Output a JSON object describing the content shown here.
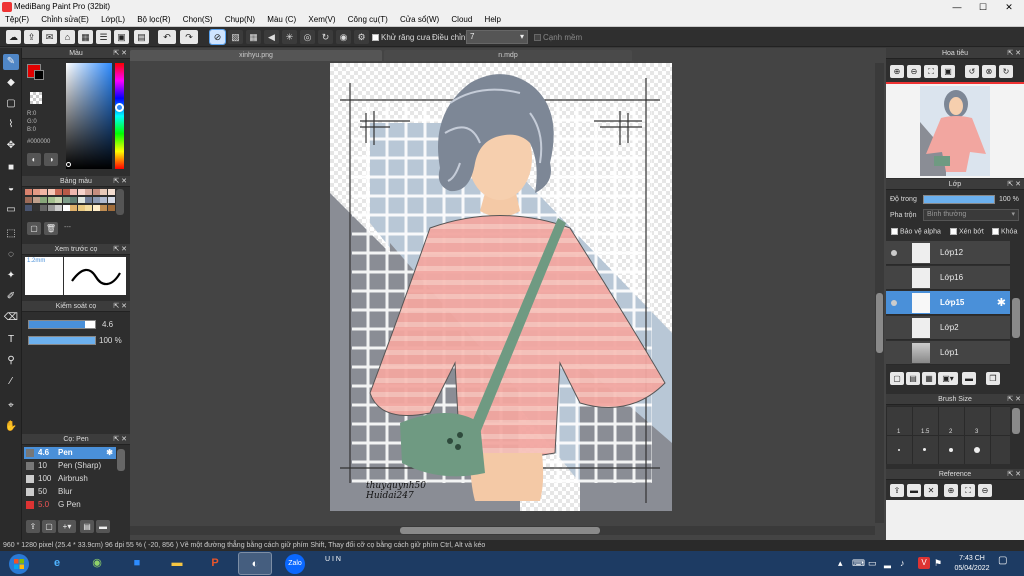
{
  "window": {
    "title": "MediBang Paint Pro (32bit)"
  },
  "menu": [
    "Tệp(F)",
    "Chỉnh sửa(E)",
    "Lớp(L)",
    "Bộ lọc(R)",
    "Chọn(S)",
    "Chụp(N)",
    "Màu (C)",
    "Xem(V)",
    "Công cụ(T)",
    "Cửa sổ(W)",
    "Cloud",
    "Help"
  ],
  "toolbar": {
    "antialias_label": "Khử răng cưa",
    "adjust_label": "Điều chỉnh",
    "adjust_value": "7",
    "snap_label": "Cạnh mềm"
  },
  "panels": {
    "color": {
      "title": "Màu",
      "r": "R:0",
      "g": "G:0",
      "b": "B:0",
      "hex": "#000000",
      "primary": "#000000",
      "secondary": "#e00000"
    },
    "palette": {
      "title": "Bảng màu",
      "more": "---"
    },
    "brush_preview": {
      "title": "Xem trước cọ",
      "size": "1.2mm"
    },
    "brush_control": {
      "title": "Kiểm soát cọ",
      "size_value": "4.6",
      "opacity_value": "100 %",
      "size_fraction": 0.85,
      "opacity_fraction": 1.0
    },
    "brushes": {
      "title": "Cọ: Pen",
      "items": [
        {
          "size": "4.6",
          "name": "Pen",
          "color": "#333333"
        },
        {
          "size": "10",
          "name": "Pen (Sharp)",
          "color": "#333333"
        },
        {
          "size": "100",
          "name": "Airbrush",
          "color": "#cccccc"
        },
        {
          "size": "50",
          "name": "Blur",
          "color": "#cccccc"
        },
        {
          "size": "5.0",
          "name": "G Pen",
          "color": "#d33"
        }
      ]
    },
    "navigator": {
      "title": "Hoa tiêu"
    },
    "layer": {
      "title": "Lớp",
      "opacity_label": "Độ trong",
      "opacity_value": "100 %",
      "opacity_fraction": 1.0,
      "blend_label": "Pha trộn",
      "blend_value": "Bình thường",
      "protect_alpha": "Bảo vệ alpha",
      "clipping": "Xén bớt",
      "lock": "Khóa",
      "items": [
        {
          "name": "Lớp12"
        },
        {
          "name": "Lớp16"
        },
        {
          "name": "Lớp15"
        },
        {
          "name": "Lớp2"
        },
        {
          "name": "Lớp1"
        }
      ]
    },
    "brush_size": {
      "title": "Brush Size",
      "labels": [
        "1",
        "1.5",
        "2",
        "3"
      ]
    },
    "reference": {
      "title": "Reference"
    }
  },
  "tabs": [
    "xinhyu.png",
    "n.mdp"
  ],
  "artwork": {
    "signature_line1": "thuyquynh50",
    "signature_line2": "Huidai247"
  },
  "status": {
    "text": "960 * 1280 pixel   (25.4 * 33.9cm)   96 dpi   55 %   ( -20, 856 )   Vẽ một đường thẳng bằng cách giữ phím Shift, Thay đổi cỡ cọ bằng cách giữ phím Ctrl, Alt và kéo"
  },
  "taskbar": {
    "time": "7:43 CH",
    "date": "05/04/2022",
    "zalo_label": "Zalo",
    "uin_label": "U I N"
  }
}
